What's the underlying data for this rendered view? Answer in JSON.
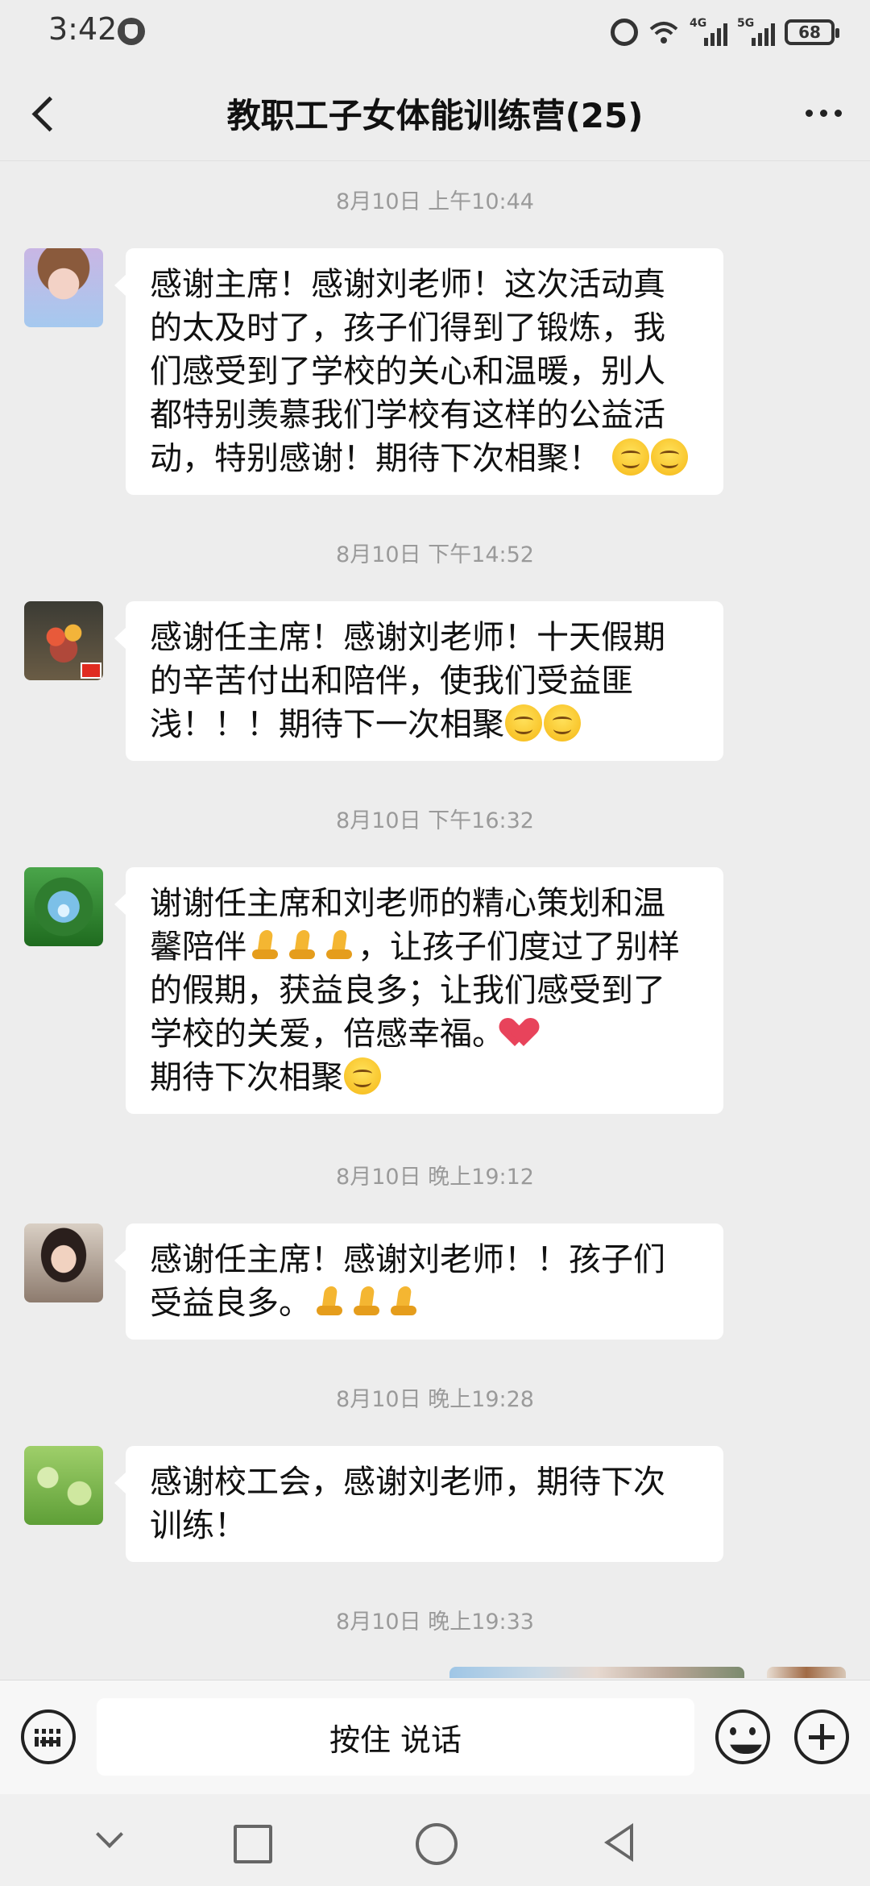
{
  "status_bar": {
    "time": "3:42",
    "battery": "68",
    "signal_tags": [
      "4G",
      "5G"
    ]
  },
  "header": {
    "title": "教职工子女体能训练营(25)"
  },
  "messages": [
    {
      "timestamp": "8月10日 上午10:44",
      "lines": [
        "感谢主席！感谢刘老师！这次活动真",
        "的太及时了，孩子们得到了锻炼，我",
        "们感受到了学校的关心和温暖，别人",
        "都特别羡慕我们学校有这样的公益活",
        "动，特别感谢！期待下次相聚！"
      ],
      "trailing_emoji": [
        "smile-emoji",
        "smile-emoji"
      ]
    },
    {
      "timestamp": "8月10日 下午14:52",
      "lines": [
        "感谢任主席！感谢刘老师！十天假期",
        "的辛苦付出和陪伴，使我们受益匪",
        "浅！！！期待下一次相聚"
      ],
      "trailing_emoji": [
        "smile-emoji",
        "smile-emoji"
      ]
    },
    {
      "timestamp": "8月10日 下午16:32",
      "lines": [
        "谢谢任主席和刘老师的精心策划和温",
        "馨陪伴",
        "，让孩子们度过了别样",
        "的假期，获益良多；让我们感受到了",
        "学校的关爱，倍感幸福。",
        "期待下次相聚"
      ],
      "trailing_emoji": [
        "pray-emoji",
        "heart-emoji",
        "smile-emoji"
      ]
    },
    {
      "timestamp": "8月10日 晚上19:12",
      "lines": [
        "感谢任主席！感谢刘老师！！孩子们",
        "受益良多。"
      ],
      "trailing_emoji": [
        "pray-emoji",
        "pray-emoji",
        "pray-emoji"
      ]
    },
    {
      "timestamp": "8月10日 晚上19:28",
      "lines": [
        "感谢校工会，感谢刘老师，期待下次",
        "训练！"
      ],
      "trailing_emoji": []
    },
    {
      "timestamp": "8月10日 晚上19:33",
      "lines": [],
      "trailing_emoji": []
    }
  ],
  "input_bar": {
    "hold_to_talk": "按住 说话"
  },
  "colors": {
    "background": "#ededed",
    "bubble": "#ffffff",
    "timestamp": "#9a9a9a"
  }
}
